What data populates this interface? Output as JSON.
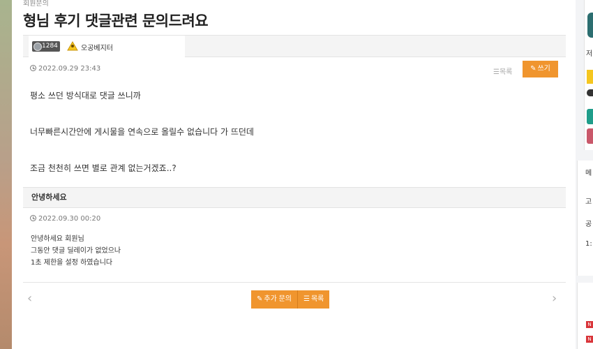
{
  "breadcrumb": "회원문의",
  "page_title": "형님 후기 댓글관련 문의드려요",
  "author": {
    "level": "1284",
    "name": "오공베지터"
  },
  "post": {
    "date": "2022.09.29 23:43",
    "list_label": "목록",
    "write_label": "쓰기",
    "lines": [
      "평소 쓰던 방식대로 댓글 쓰니까",
      "너무빠른시간안에 게시물을 연속으로 올릴수 없습니다 가 뜨던데",
      "조금 천천히 쓰면 별로 관계 없는거겠죠..?"
    ]
  },
  "reply": {
    "title": "안녕하세요",
    "date": "2022.09.30 00:20",
    "lines": [
      "안녕하세요 회원님",
      "그동안 댓글 딜레이가 없었으나",
      "1초 제한을 설정 하였습니다"
    ]
  },
  "actions": {
    "more_inquiry": "추가 문의",
    "list": "목록"
  },
  "right_panel": {
    "text1": "저",
    "menu_label": "메",
    "item1": "고",
    "item2": "공",
    "item3": "1:",
    "badge": "N"
  },
  "colors": {
    "accent": "#f0952e",
    "teal": "#1f9d8a",
    "rose": "#c9586a",
    "new_badge": "#d9353a"
  },
  "icons": {
    "clock": "clock-icon",
    "pencil": "pencil-icon",
    "lines": "list-icon",
    "prev": "chevron-left-icon",
    "next": "chevron-right-icon"
  }
}
